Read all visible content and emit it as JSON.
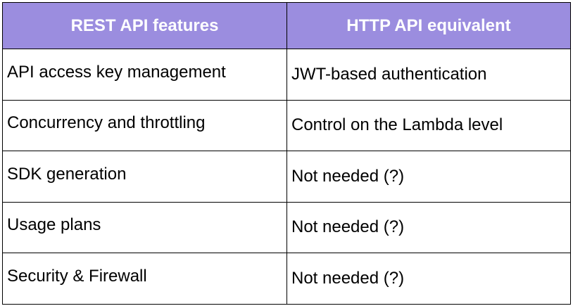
{
  "table": {
    "headers": [
      "REST API features",
      "HTTP API equivalent"
    ],
    "rows": [
      [
        "API access key management",
        "JWT-based authentication"
      ],
      [
        "Concurrency and throttling",
        "Control on the Lambda level"
      ],
      [
        "SDK generation",
        "Not needed (?)"
      ],
      [
        "Usage plans",
        "Not needed (?)"
      ],
      [
        "Security & Firewall",
        "Not needed (?)"
      ]
    ]
  },
  "colors": {
    "header_bg": "#9b8ddf",
    "header_text": "#ffffff",
    "border": "#000000",
    "body_text": "#000000"
  }
}
